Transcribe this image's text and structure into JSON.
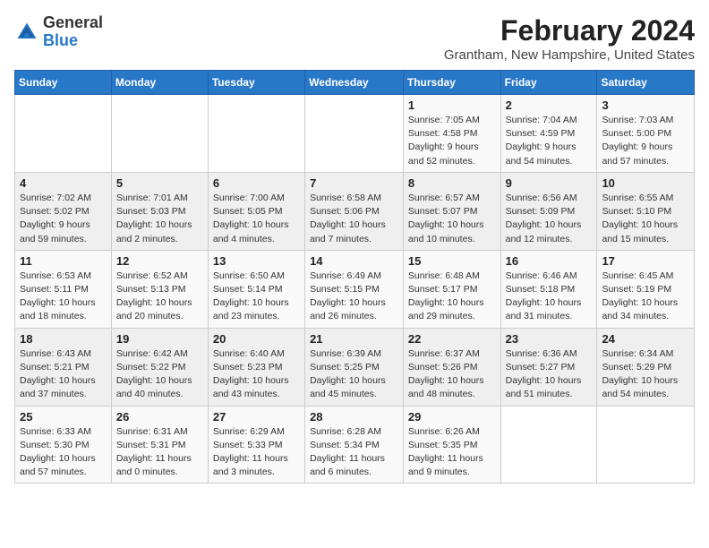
{
  "header": {
    "logo": {
      "general": "General",
      "blue": "Blue"
    },
    "title": "February 2024",
    "location": "Grantham, New Hampshire, United States"
  },
  "days_of_week": [
    "Sunday",
    "Monday",
    "Tuesday",
    "Wednesday",
    "Thursday",
    "Friday",
    "Saturday"
  ],
  "weeks": [
    [
      {
        "day": null,
        "info": null
      },
      {
        "day": null,
        "info": null
      },
      {
        "day": null,
        "info": null
      },
      {
        "day": null,
        "info": null
      },
      {
        "day": "1",
        "info": "Sunrise: 7:05 AM\nSunset: 4:58 PM\nDaylight: 9 hours\nand 52 minutes."
      },
      {
        "day": "2",
        "info": "Sunrise: 7:04 AM\nSunset: 4:59 PM\nDaylight: 9 hours\nand 54 minutes."
      },
      {
        "day": "3",
        "info": "Sunrise: 7:03 AM\nSunset: 5:00 PM\nDaylight: 9 hours\nand 57 minutes."
      }
    ],
    [
      {
        "day": "4",
        "info": "Sunrise: 7:02 AM\nSunset: 5:02 PM\nDaylight: 9 hours\nand 59 minutes."
      },
      {
        "day": "5",
        "info": "Sunrise: 7:01 AM\nSunset: 5:03 PM\nDaylight: 10 hours\nand 2 minutes."
      },
      {
        "day": "6",
        "info": "Sunrise: 7:00 AM\nSunset: 5:05 PM\nDaylight: 10 hours\nand 4 minutes."
      },
      {
        "day": "7",
        "info": "Sunrise: 6:58 AM\nSunset: 5:06 PM\nDaylight: 10 hours\nand 7 minutes."
      },
      {
        "day": "8",
        "info": "Sunrise: 6:57 AM\nSunset: 5:07 PM\nDaylight: 10 hours\nand 10 minutes."
      },
      {
        "day": "9",
        "info": "Sunrise: 6:56 AM\nSunset: 5:09 PM\nDaylight: 10 hours\nand 12 minutes."
      },
      {
        "day": "10",
        "info": "Sunrise: 6:55 AM\nSunset: 5:10 PM\nDaylight: 10 hours\nand 15 minutes."
      }
    ],
    [
      {
        "day": "11",
        "info": "Sunrise: 6:53 AM\nSunset: 5:11 PM\nDaylight: 10 hours\nand 18 minutes."
      },
      {
        "day": "12",
        "info": "Sunrise: 6:52 AM\nSunset: 5:13 PM\nDaylight: 10 hours\nand 20 minutes."
      },
      {
        "day": "13",
        "info": "Sunrise: 6:50 AM\nSunset: 5:14 PM\nDaylight: 10 hours\nand 23 minutes."
      },
      {
        "day": "14",
        "info": "Sunrise: 6:49 AM\nSunset: 5:15 PM\nDaylight: 10 hours\nand 26 minutes."
      },
      {
        "day": "15",
        "info": "Sunrise: 6:48 AM\nSunset: 5:17 PM\nDaylight: 10 hours\nand 29 minutes."
      },
      {
        "day": "16",
        "info": "Sunrise: 6:46 AM\nSunset: 5:18 PM\nDaylight: 10 hours\nand 31 minutes."
      },
      {
        "day": "17",
        "info": "Sunrise: 6:45 AM\nSunset: 5:19 PM\nDaylight: 10 hours\nand 34 minutes."
      }
    ],
    [
      {
        "day": "18",
        "info": "Sunrise: 6:43 AM\nSunset: 5:21 PM\nDaylight: 10 hours\nand 37 minutes."
      },
      {
        "day": "19",
        "info": "Sunrise: 6:42 AM\nSunset: 5:22 PM\nDaylight: 10 hours\nand 40 minutes."
      },
      {
        "day": "20",
        "info": "Sunrise: 6:40 AM\nSunset: 5:23 PM\nDaylight: 10 hours\nand 43 minutes."
      },
      {
        "day": "21",
        "info": "Sunrise: 6:39 AM\nSunset: 5:25 PM\nDaylight: 10 hours\nand 45 minutes."
      },
      {
        "day": "22",
        "info": "Sunrise: 6:37 AM\nSunset: 5:26 PM\nDaylight: 10 hours\nand 48 minutes."
      },
      {
        "day": "23",
        "info": "Sunrise: 6:36 AM\nSunset: 5:27 PM\nDaylight: 10 hours\nand 51 minutes."
      },
      {
        "day": "24",
        "info": "Sunrise: 6:34 AM\nSunset: 5:29 PM\nDaylight: 10 hours\nand 54 minutes."
      }
    ],
    [
      {
        "day": "25",
        "info": "Sunrise: 6:33 AM\nSunset: 5:30 PM\nDaylight: 10 hours\nand 57 minutes."
      },
      {
        "day": "26",
        "info": "Sunrise: 6:31 AM\nSunset: 5:31 PM\nDaylight: 11 hours\nand 0 minutes."
      },
      {
        "day": "27",
        "info": "Sunrise: 6:29 AM\nSunset: 5:33 PM\nDaylight: 11 hours\nand 3 minutes."
      },
      {
        "day": "28",
        "info": "Sunrise: 6:28 AM\nSunset: 5:34 PM\nDaylight: 11 hours\nand 6 minutes."
      },
      {
        "day": "29",
        "info": "Sunrise: 6:26 AM\nSunset: 5:35 PM\nDaylight: 11 hours\nand 9 minutes."
      },
      {
        "day": null,
        "info": null
      },
      {
        "day": null,
        "info": null
      }
    ]
  ]
}
